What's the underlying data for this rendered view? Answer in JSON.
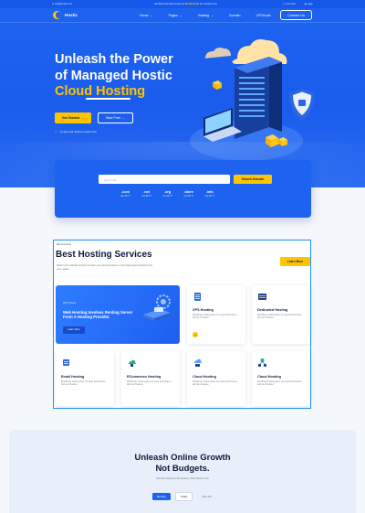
{
  "topbar": {
    "email": "info@hostic.com",
    "promo_prefix": "Get Big Deal Web Hosting at",
    "promo_highlight": "$2.99/month",
    "promo_suffix": "for a limited time",
    "live_chat": "Live Chat",
    "login": "Login"
  },
  "nav": {
    "brand": "Hostic",
    "items": [
      {
        "label": "Home",
        "has_dropdown": true
      },
      {
        "label": "Pages",
        "has_dropdown": true
      },
      {
        "label": "Hosting",
        "has_dropdown": true
      },
      {
        "label": "Domain",
        "has_dropdown": false
      },
      {
        "label": "VPSHosts",
        "has_dropdown": false
      }
    ],
    "contact": "Contact Us"
  },
  "hero": {
    "title_line1": "Unleash the Power",
    "title_line2": "of Managed Hostic",
    "title_line3": "Cloud Hosting",
    "btn_primary": "Get Started",
    "btn_secondary": "Start Free",
    "trial_note": "14 day trial without credit card"
  },
  "domain_search": {
    "placeholder": "gmbb.com",
    "button": "Search Domain",
    "tlds": [
      {
        "name": ".com",
        "price": "only $6.77"
      },
      {
        "name": ".net",
        "price": "only $6.77"
      },
      {
        "name": ".org",
        "price": "only $6.77"
      },
      {
        "name": ".store",
        "price": "only $6.77"
      },
      {
        "name": ".info",
        "price": "only $6.77"
      }
    ]
  },
  "services": {
    "tag": "Best Hosting",
    "title": "Best Hosting Services",
    "description": "Select your website and do not hate your services base on best high speed options to fit your needs.",
    "learn_more": "Learn More",
    "feature": {
      "tag": "Web Hosting",
      "title": "Web Hosting Involves Renting Server From A Hosting Provider.",
      "button": "Learn More"
    },
    "cards": [
      {
        "title": "VPS Hosting",
        "desc": "WordPress hosting gives our great performance with lot of feature.",
        "icon": "server-icon"
      },
      {
        "title": "Dedicated Hosting",
        "desc": "WordPress hosting gives our great performance with lot of feature.",
        "icon": "dedicated-server-icon"
      },
      {
        "title": "Email Hosting",
        "desc": "WordPress hosting gives our great performance with lot of feature.",
        "icon": "email-server-icon"
      },
      {
        "title": "ECommerce Hosting",
        "desc": "WordPress hosting gives our great performance with lot of feature.",
        "icon": "ecommerce-cloud-icon"
      },
      {
        "title": "Cloud Hosting",
        "desc": "WordPress hosting gives our great performance with lot of feature.",
        "icon": "cloud-server-icon"
      },
      {
        "title": "Cloud Hosting",
        "desc": "WordPress hosting gives our great performance with lot of feature.",
        "icon": "network-icon"
      }
    ]
  },
  "pricing": {
    "title_line1": "Unleash Online Growth",
    "title_line2": "Not Budgets.",
    "subtitle": "Forever hosting in the options, think about in hot",
    "toggles": [
      "Monthly",
      "Yearly",
      "20% Off"
    ]
  },
  "colors": {
    "primary": "#1D63F0",
    "accent": "#FFC400",
    "highlight_border": "#1E90FF"
  }
}
